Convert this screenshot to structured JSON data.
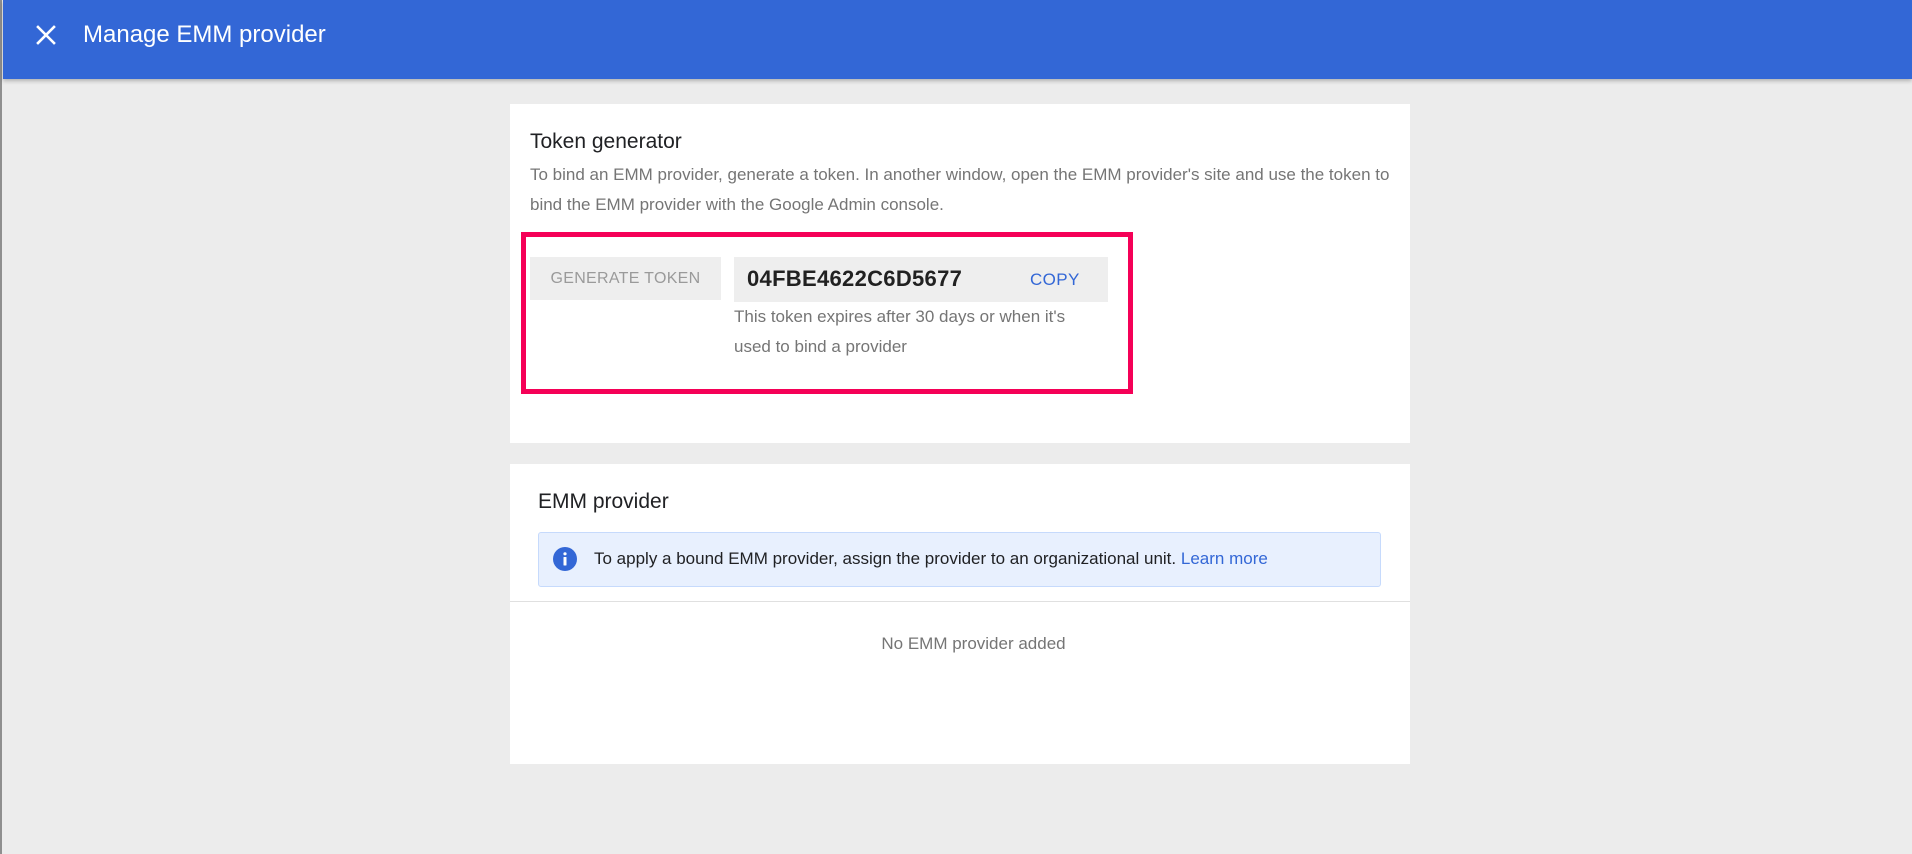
{
  "window": {
    "title": "Manage EMM provider",
    "close_icon": "close-icon"
  },
  "colors": {
    "header_bg": "#3367d6",
    "page_bg": "#ececec",
    "highlight": "#f50057",
    "link": "#3367d6",
    "info_bg": "#e8f0fe"
  },
  "token_generator": {
    "title": "Token generator",
    "description": "To bind an EMM provider, generate a token. In another window, open the EMM provider's site and use the token to bind the EMM provider with the Google Admin console.",
    "generate_label": "GENERATE TOKEN",
    "token_value": "04FBE4622C6D5677",
    "copy_label": "COPY",
    "token_note": "This token expires after 30 days or when it's used to bind a provider"
  },
  "emm_provider": {
    "title": "EMM provider",
    "info_icon": "info-icon",
    "info_text": "To apply a bound EMM provider, assign the provider to an organizational unit.",
    "learn_more_label": "Learn more",
    "empty_text": "No EMM provider added"
  }
}
